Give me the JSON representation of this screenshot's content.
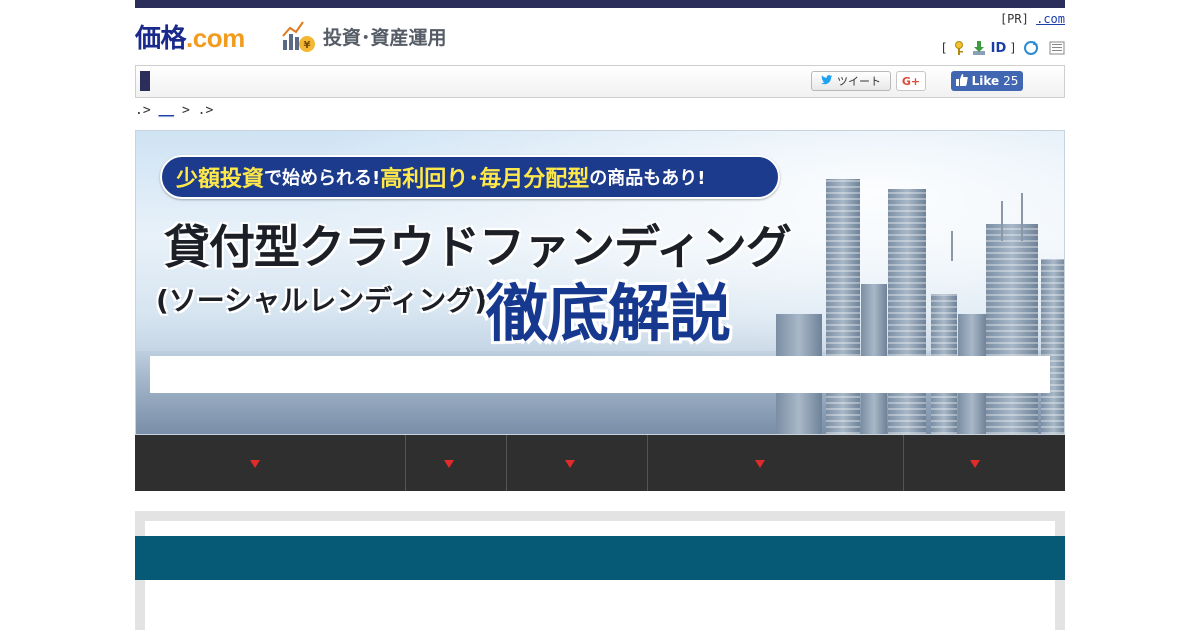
{
  "header": {
    "logo_text_1": "価格",
    "logo_text_2": ".com",
    "section_title": "投資･資産運用",
    "pr_label": "[PR]",
    "pr_link": ".com",
    "util_bracket_open": "[",
    "util_id": "ID",
    "util_bracket_close": "]"
  },
  "share": {
    "tweet_label": "ツイート",
    "gplus_label": "G+",
    "like_label": "Like",
    "like_count": "25"
  },
  "breadcrumb": {
    "sep1": ".>",
    "link": "__",
    "sep2": ">",
    "sep3": ".>"
  },
  "hero": {
    "pill_part1": "少額投資",
    "pill_part2": "で始められる!",
    "pill_part3": "高利回り･毎月分配型",
    "pill_part4": "の商品もあり!",
    "title_line1": "貸付型クラウドファンディング",
    "title_line2": "(ソーシャルレンディング)",
    "title_line3": "徹底解説"
  },
  "nav": {
    "items": [
      "",
      "",
      "",
      "",
      ""
    ]
  },
  "colors": {
    "topbar": "#2b2d5a",
    "nav_bg": "#2f2f2f",
    "nav_marker": "#e02b2b",
    "section_band": "#075a76",
    "brand_blue": "#1a2a8c",
    "brand_orange": "#f29c1f"
  },
  "icons": [
    "bar-chart-yen-icon",
    "key-icon",
    "download-icon",
    "refresh-icon",
    "list-icon",
    "twitter-bird-icon",
    "facebook-thumb-icon",
    "triangle-down-icon"
  ]
}
